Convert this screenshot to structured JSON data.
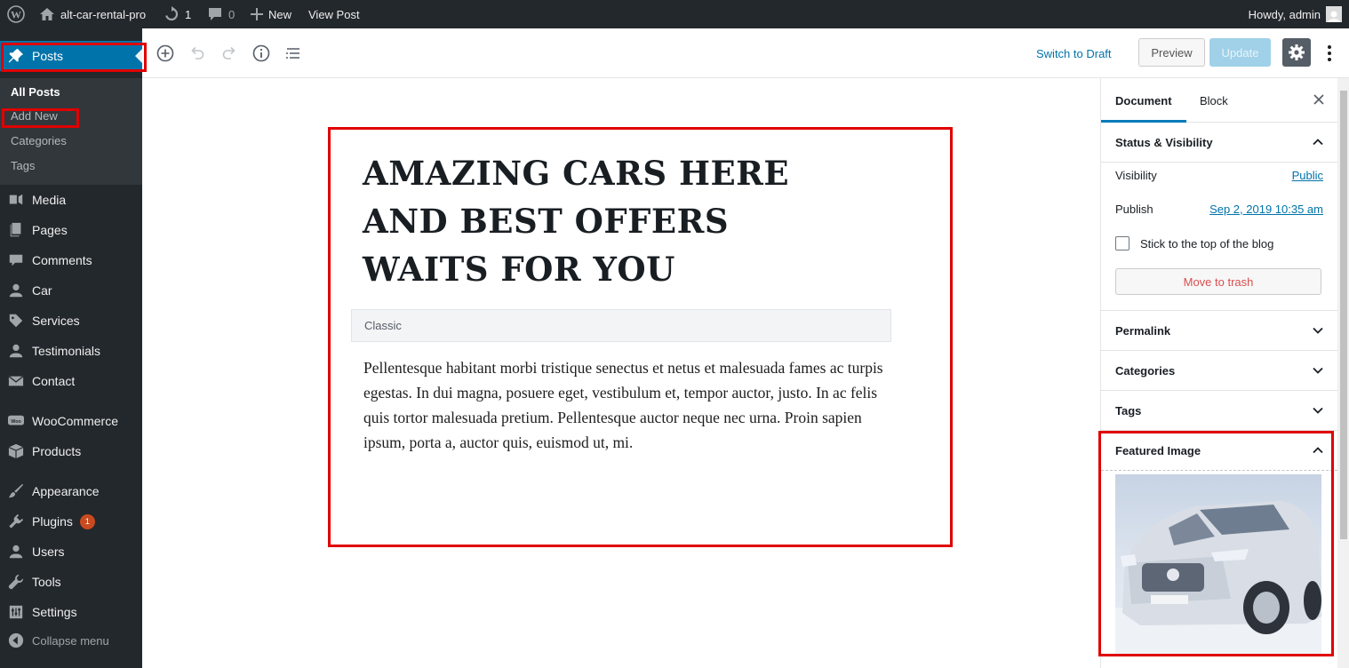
{
  "admin_bar": {
    "site_name": "alt-car-rental-pro",
    "updates_count": "1",
    "comments_count": "0",
    "new_label": "New",
    "view_post_label": "View Post",
    "greeting": "Howdy, admin"
  },
  "sidebar": {
    "items": [
      {
        "label": "Posts",
        "icon": "pin-icon"
      },
      {
        "label": "Media",
        "icon": "media-icon"
      },
      {
        "label": "Pages",
        "icon": "pages-icon"
      },
      {
        "label": "Comments",
        "icon": "comments-icon"
      },
      {
        "label": "Car",
        "icon": "user-icon"
      },
      {
        "label": "Services",
        "icon": "tag-icon"
      },
      {
        "label": "Testimonials",
        "icon": "user-icon"
      },
      {
        "label": "Contact",
        "icon": "mail-icon"
      },
      {
        "label": "WooCommerce",
        "icon": "woo-icon"
      },
      {
        "label": "Products",
        "icon": "box-icon"
      },
      {
        "label": "Appearance",
        "icon": "brush-icon"
      },
      {
        "label": "Plugins",
        "icon": "plug-icon",
        "badge": "1"
      },
      {
        "label": "Users",
        "icon": "user-icon"
      },
      {
        "label": "Tools",
        "icon": "wrench-icon"
      },
      {
        "label": "Settings",
        "icon": "settings-icon"
      }
    ],
    "submenu": [
      "All Posts",
      "Add New",
      "Categories",
      "Tags"
    ],
    "collapse_label": "Collapse menu"
  },
  "toolbar": {
    "switch_to_draft": "Switch to Draft",
    "preview": "Preview",
    "update": "Update"
  },
  "post": {
    "title": "AMAZING CARS HERE AND BEST OFFERS WAITS FOR YOU",
    "block_label": "Classic",
    "body": "Pellentesque habitant morbi tristique senectus et netus et malesuada fames ac turpis egestas. In dui magna, posuere eget, vestibulum et, tempor auctor, justo. In ac felis quis tortor malesuada pretium. Pellentesque auctor neque nec urna. Proin sapien ipsum, porta a, auctor quis, euismod ut, mi."
  },
  "settings_panel": {
    "tabs": [
      "Document",
      "Block"
    ],
    "status_title": "Status & Visibility",
    "visibility_label": "Visibility",
    "visibility_value": "Public",
    "publish_label": "Publish",
    "publish_value": "Sep 2, 2019 10:35 am",
    "sticky_label": "Stick to the top of the blog",
    "trash_label": "Move to trash",
    "permalink_title": "Permalink",
    "categories_title": "Categories",
    "tags_title": "Tags",
    "featured_title": "Featured Image"
  },
  "colors": {
    "admin_bg": "#23282d",
    "active_menu": "#0073aa",
    "highlight": "#e00000",
    "link": "#0073aa"
  }
}
